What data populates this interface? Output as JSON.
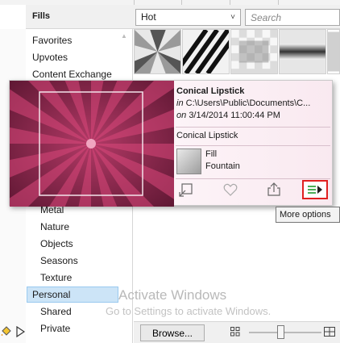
{
  "header": {
    "title": "Fills",
    "filter_value": "Hot",
    "search_placeholder": "Search"
  },
  "categories": {
    "top": [
      "Favorites",
      "Upvotes",
      "Content Exchange"
    ],
    "sub": [
      "Metal",
      "Nature",
      "Objects",
      "Seasons",
      "Texture"
    ],
    "selected": "Personal",
    "after": [
      "Shared",
      "Private"
    ]
  },
  "popup": {
    "name": "Conical Lipstick",
    "path_prefix": "in",
    "path": "C:\\Users\\Public\\Documents\\C...",
    "date_prefix": "on",
    "date": "3/14/2014 11:00:44 PM",
    "name_repeat": "Conical Lipstick",
    "fill_type": "Fill",
    "fill_kind": "Fountain",
    "preview_colors": [
      "#6b1b35",
      "#d8477a",
      "#3f0a1f"
    ]
  },
  "tooltip": "More options",
  "bottom": {
    "browse_label": "Browse..."
  },
  "watermark": {
    "title": "Activate Windows",
    "subtitle": "Go to Settings to activate Windows."
  },
  "icons": {
    "bucket": "paint-bucket-icon",
    "expand": "expand-triangle-icon",
    "apply": "apply-icon",
    "favorite": "heart-icon",
    "share": "share-icon",
    "more": "more-options-icon",
    "grid_small": "small-thumbnails-icon",
    "grid_large": "large-thumbnails-icon"
  }
}
